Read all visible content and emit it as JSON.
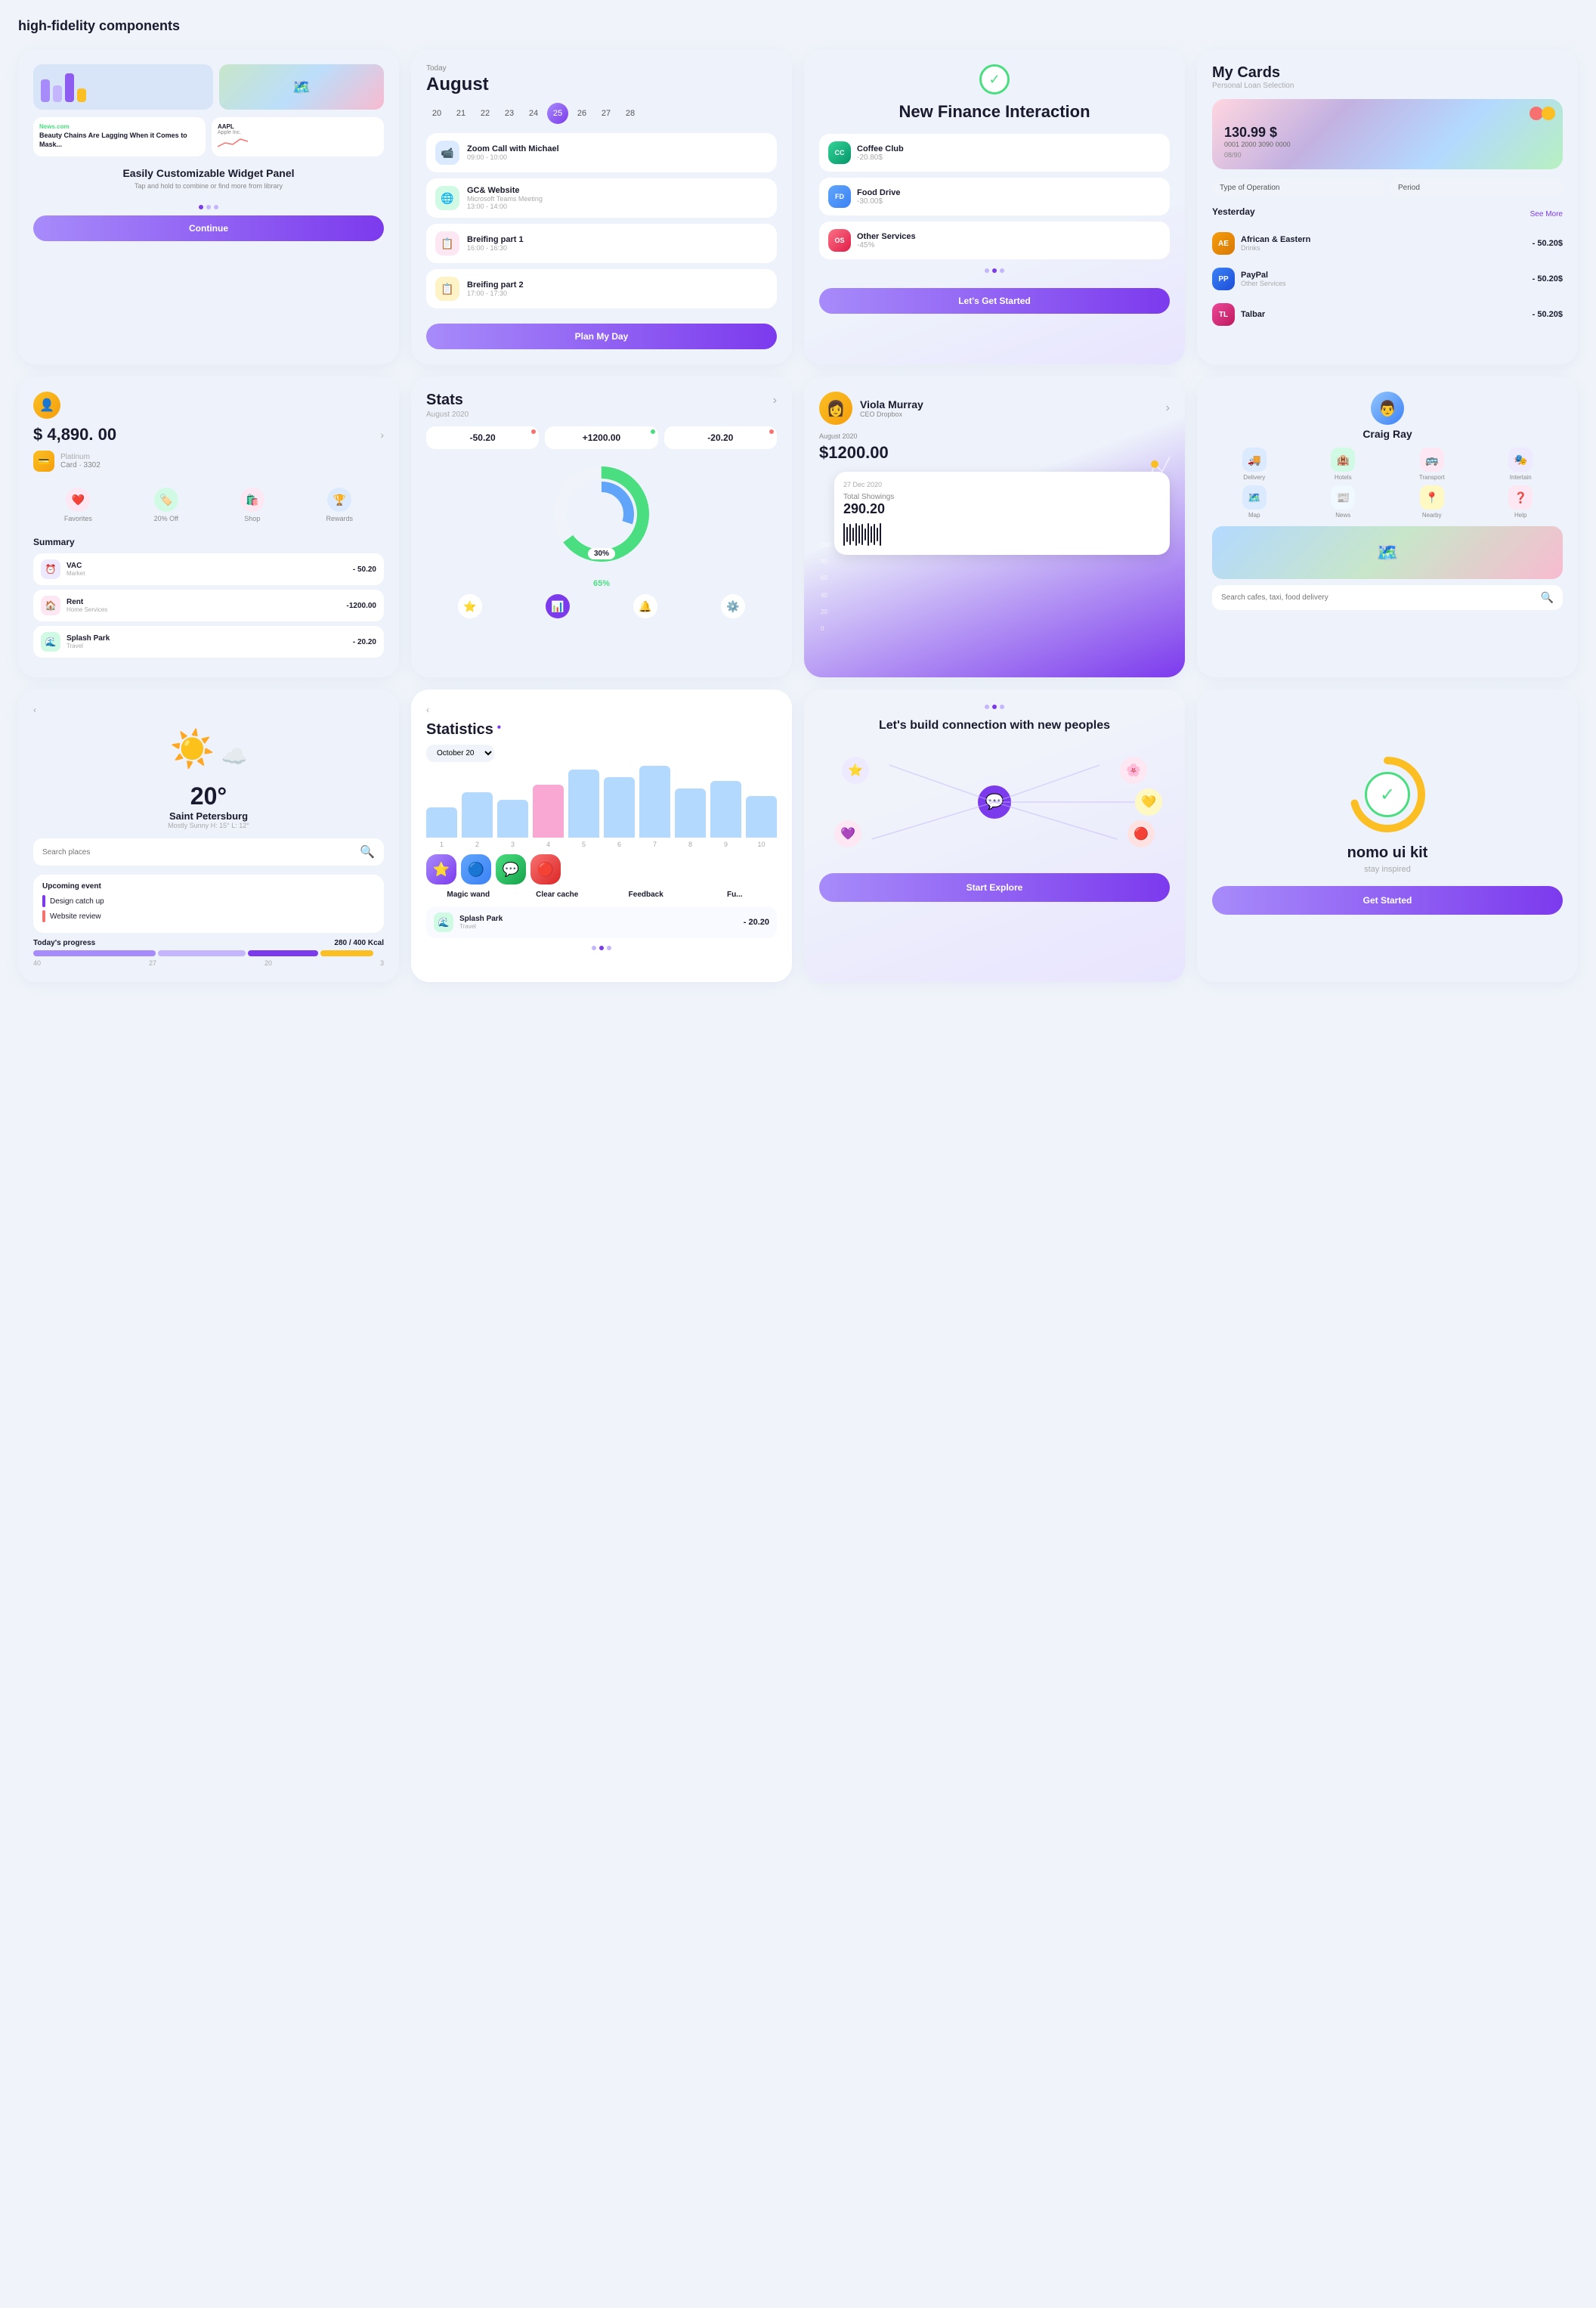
{
  "page": {
    "title": "high-fidelity components"
  },
  "card1": {
    "bars": [
      "purple",
      "light-purple",
      "dark-purple",
      "yellow"
    ],
    "news": [
      {
        "source": "News.com",
        "headline": "Beauty Chains Are Lagging When it Comes to Mask..."
      },
      {
        "name": "AAPL",
        "sub": "Apple Inc.",
        "trend": "down"
      }
    ],
    "title": "Easily Customizable Widget Panel",
    "subtitle": "Tap and hold to combine or find more from library",
    "button": "Continue",
    "dots": [
      true,
      false,
      false
    ]
  },
  "card2": {
    "today_label": "Today",
    "month": "August",
    "days": [
      "20",
      "21",
      "22",
      "23",
      "24",
      "25",
      "26",
      "27",
      "28"
    ],
    "active_day": "25",
    "events": [
      {
        "icon": "📹",
        "color": "zoom",
        "title": "Zoom Call with Michael",
        "time": "09:00 - 10:00"
      },
      {
        "icon": "🌐",
        "color": "gc",
        "title": "GC& Website",
        "subtitle": "Microsoft Teams Meeting",
        "time": "13:00 - 14:00"
      },
      {
        "icon": "📋",
        "color": "br1",
        "title": "Breifing part 1",
        "time": "16:00 - 16:30"
      },
      {
        "icon": "📋",
        "color": "br2",
        "title": "Breifing part 2",
        "time": "17:00 - 17:30"
      }
    ],
    "button": "Plan My Day"
  },
  "card3": {
    "title": "New Finance Interaction",
    "transactions": [
      {
        "badge": "CC",
        "color": "badge-cc",
        "name": "Coffee Club",
        "amount": "-20.80$"
      },
      {
        "badge": "FD",
        "color": "badge-fd",
        "name": "Food Drive",
        "amount": "-30.00$"
      },
      {
        "badge": "OS",
        "color": "badge-os",
        "name": "Other Services",
        "amount": "-45%"
      }
    ],
    "button": "Let's Get Started"
  },
  "card4": {
    "title": "My Cards",
    "subtitle": "Personal Loan Selection",
    "card_amount": "130.99 $",
    "card_number": "0001 2000 3090 0000",
    "card_exp": "08/90",
    "filter1": "Type of Operation",
    "filter2": "Period",
    "section": "Yesterday",
    "see_more": "See More",
    "transactions": [
      {
        "initials": "AE",
        "color": "ti-ae",
        "name": "African & Eastern",
        "category": "Drinks",
        "amount": "- 50.20$"
      },
      {
        "initials": "PP",
        "color": "ti-pp",
        "name": "PayPal",
        "category": "Other Services",
        "amount": "- 50.20$"
      },
      {
        "initials": "TL",
        "color": "ti-tl",
        "name": "Talbar",
        "category": "",
        "amount": "- 50.20$"
      }
    ]
  },
  "card5": {
    "balance": "$ 4,890. 00",
    "card_name": "Platinum",
    "card_num": "Card · 3302",
    "icons": [
      {
        "label": "Favorites",
        "emoji": "❤️",
        "bg": "ic-heart"
      },
      {
        "label": "20% Off",
        "emoji": "🏷️",
        "bg": "ic-shop"
      },
      {
        "label": "Shop",
        "emoji": "🛍️",
        "bg": "ic-bag"
      },
      {
        "label": "Rewards",
        "emoji": "🏆",
        "bg": "ic-reward"
      }
    ],
    "summary_title": "Summary",
    "items": [
      {
        "icon": "⏰",
        "bg": "si-vac",
        "name": "VAC",
        "cat": "Market",
        "amount": "- 50.20"
      },
      {
        "icon": "🏠",
        "bg": "si-rent",
        "name": "Rent",
        "cat": "Home Services",
        "amount": "-1200.00"
      },
      {
        "icon": "🌊",
        "bg": "si-sp",
        "name": "Splash Park",
        "cat": "Travel",
        "amount": "- 20.20"
      }
    ]
  },
  "card6": {
    "title": "Stats",
    "subtitle": "August 2020",
    "chips": [
      "-50.20",
      "+1200.00",
      "-20.20"
    ],
    "chip_badges": [
      "red",
      "green",
      "red"
    ],
    "donut_pct_outer": 65,
    "donut_pct_inner": 30,
    "bottom_icons": [
      "⭐",
      "📊",
      "🔔",
      "⚙️"
    ]
  },
  "card7": {
    "avatar": "👩",
    "name": "Viola Murray",
    "role": "CEO Dropbox",
    "period": "August 2020",
    "balance": "$1200.00",
    "ticket_date": "27 Dec 2020",
    "ticket_label": "Total Showings",
    "ticket_amount": "290.20"
  },
  "card8": {
    "avatar": "👨",
    "name": "Craig Ray",
    "services": [
      {
        "icon": "🚚",
        "bg": "sg-delivery",
        "label": "Delivery"
      },
      {
        "icon": "🏨",
        "bg": "sg-hotels",
        "label": "Hotels"
      },
      {
        "icon": "🚌",
        "bg": "sg-transport",
        "label": "Transport"
      },
      {
        "icon": "🎭",
        "bg": "sg-entertain",
        "label": "Intertain"
      },
      {
        "icon": "🗺️",
        "bg": "sg-map",
        "label": "Map"
      },
      {
        "icon": "📰",
        "bg": "sg-news",
        "label": "News"
      },
      {
        "icon": "📍",
        "bg": "sg-nearby",
        "label": "Nearby"
      },
      {
        "icon": "❓",
        "bg": "sg-help",
        "label": "Help"
      }
    ],
    "search_placeholder": "Search cafes, taxi, food delivery"
  },
  "card9": {
    "temp": "20°",
    "city": "Saint Petersburg",
    "desc": "Mostly Sunny  H: 15° L: 12°",
    "search_placeholder": "Search places",
    "upcoming_title": "Upcoming event",
    "events": [
      {
        "color": "pill-design",
        "text": "Design catch up"
      },
      {
        "color": "pill-website",
        "text": "Website review"
      }
    ],
    "progress_title": "Today's progress",
    "progress_value": "280 / 400 Kcal",
    "progress_bars": [
      {
        "color": "#a78bfa",
        "width": "35%"
      },
      {
        "color": "#c4b5fd",
        "width": "25%"
      },
      {
        "color": "#7c3aed",
        "width": "20%"
      },
      {
        "color": "#fbbf24",
        "width": "15%"
      }
    ],
    "progress_labels": [
      "40",
      "27",
      "20",
      "3"
    ]
  },
  "card10": {
    "title": "Statistics",
    "period": "October 20",
    "bars": [
      {
        "label": "1",
        "height": 40,
        "color": "#b3d9ff"
      },
      {
        "label": "2",
        "height": 60,
        "color": "#b3d9ff"
      },
      {
        "label": "3",
        "height": 50,
        "color": "#b3d9ff"
      },
      {
        "label": "4",
        "height": 70,
        "color": "#f9a8d4"
      },
      {
        "label": "5",
        "height": 90,
        "color": "#b3d9ff"
      },
      {
        "label": "6",
        "height": 80,
        "color": "#b3d9ff"
      },
      {
        "label": "7",
        "height": 95,
        "color": "#b3d9ff"
      },
      {
        "label": "8",
        "height": 65,
        "color": "#b3d9ff"
      },
      {
        "label": "9",
        "height": 75,
        "color": "#b3d9ff"
      },
      {
        "label": "10",
        "height": 55,
        "color": "#b3d9ff"
      }
    ],
    "apps": [
      {
        "icon": "⭐",
        "bg": "ai-star",
        "name": "Magic wand"
      },
      {
        "icon": "🔵",
        "bg": "ai-blue",
        "name": "Clear cache"
      },
      {
        "icon": "💬",
        "bg": "ai-green",
        "name": "Feedback"
      },
      {
        "icon": "🔴",
        "bg": "ai-red",
        "name": "Fu..."
      }
    ],
    "bottom_item": {
      "icon": "🌊",
      "name": "Splash Park",
      "cat": "Travel",
      "amount": "- 20.20"
    }
  },
  "card11": {
    "title": "Let's build connection with new peoples",
    "nodes": [
      "💬",
      "⭐",
      "🌸",
      "💜",
      "🔴",
      "💛"
    ],
    "button": "Start Explore"
  },
  "card12": {
    "title": "nomo ui kit",
    "subtitle": "stay inspired",
    "button": "Get Started"
  }
}
